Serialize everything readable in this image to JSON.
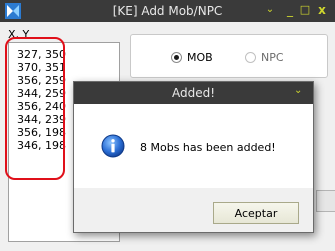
{
  "window": {
    "title": "[KE] Add Mob/NPC",
    "controls": {
      "chevron": "⌄",
      "minimize": "_",
      "maximize": "□",
      "close": "x"
    },
    "accent": "#cfd72e"
  },
  "coords": {
    "header": "X, Y",
    "items": [
      "327, 350",
      "370, 351",
      "356, 259",
      "344, 259",
      "356, 240",
      "344, 239",
      "356, 198",
      "346, 198"
    ],
    "highlight_color": "#e0101a"
  },
  "type_selector": {
    "options": [
      {
        "label": "MOB",
        "selected": true
      },
      {
        "label": "NPC",
        "selected": false
      }
    ]
  },
  "dialog": {
    "title": "Added!",
    "chevron": "⌄",
    "icon": "info-icon",
    "message": "8 Mobs has been added!",
    "ok_label": "Aceptar"
  }
}
